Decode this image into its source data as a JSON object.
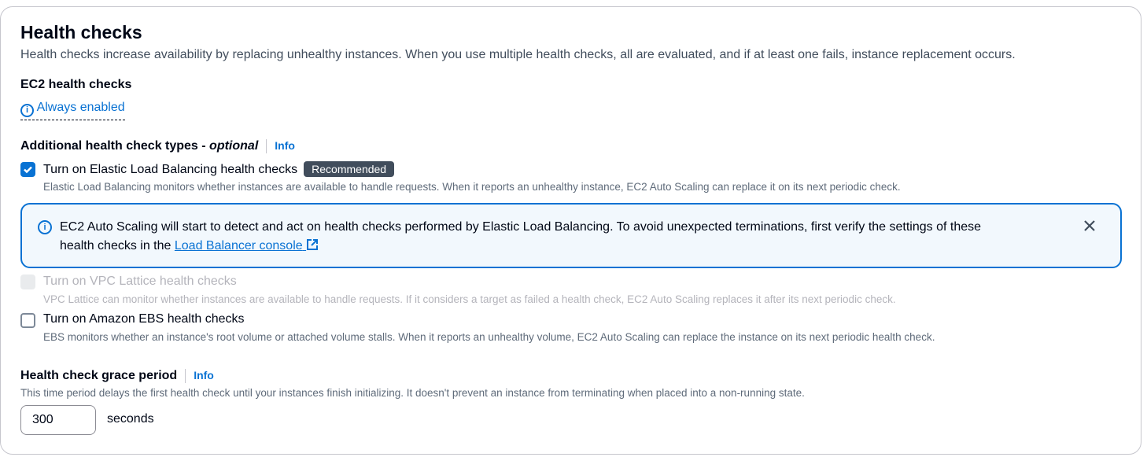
{
  "title": "Health checks",
  "description": "Health checks increase availability by replacing unhealthy instances. When you use multiple health checks, all are evaluated, and if at least one fails, instance replacement occurs.",
  "ec2": {
    "label": "EC2 health checks",
    "value": "Always enabled"
  },
  "additional": {
    "label": "Additional health check types - ",
    "optional": "optional",
    "info": "Info"
  },
  "elb": {
    "label": "Turn on Elastic Load Balancing health checks",
    "badge": "Recommended",
    "checked": true,
    "description": "Elastic Load Balancing monitors whether instances are available to handle requests. When it reports an unhealthy instance, EC2 Auto Scaling can replace it on its next periodic check."
  },
  "alert": {
    "text1": "EC2 Auto Scaling will start to detect and act on health checks performed by Elastic Load Balancing. To avoid unexpected terminations, first verify the settings of these",
    "text2": "health checks in the ",
    "link": "Load Balancer console"
  },
  "vpc": {
    "label": "Turn on VPC Lattice health checks",
    "checked": false,
    "disabled": true,
    "description": "VPC Lattice can monitor whether instances are available to handle requests. If it considers a target as failed a health check, EC2 Auto Scaling replaces it after its next periodic check."
  },
  "ebs": {
    "label": "Turn on Amazon EBS health checks",
    "checked": false,
    "description": "EBS monitors whether an instance's root volume or attached volume stalls. When it reports an unhealthy volume, EC2 Auto Scaling can replace the instance on its next periodic health check."
  },
  "grace": {
    "label": "Health check grace period",
    "info": "Info",
    "description": "This time period delays the first health check until your instances finish initializing. It doesn't prevent an instance from terminating when placed into a non-running state.",
    "value": "300",
    "unit": "seconds"
  }
}
